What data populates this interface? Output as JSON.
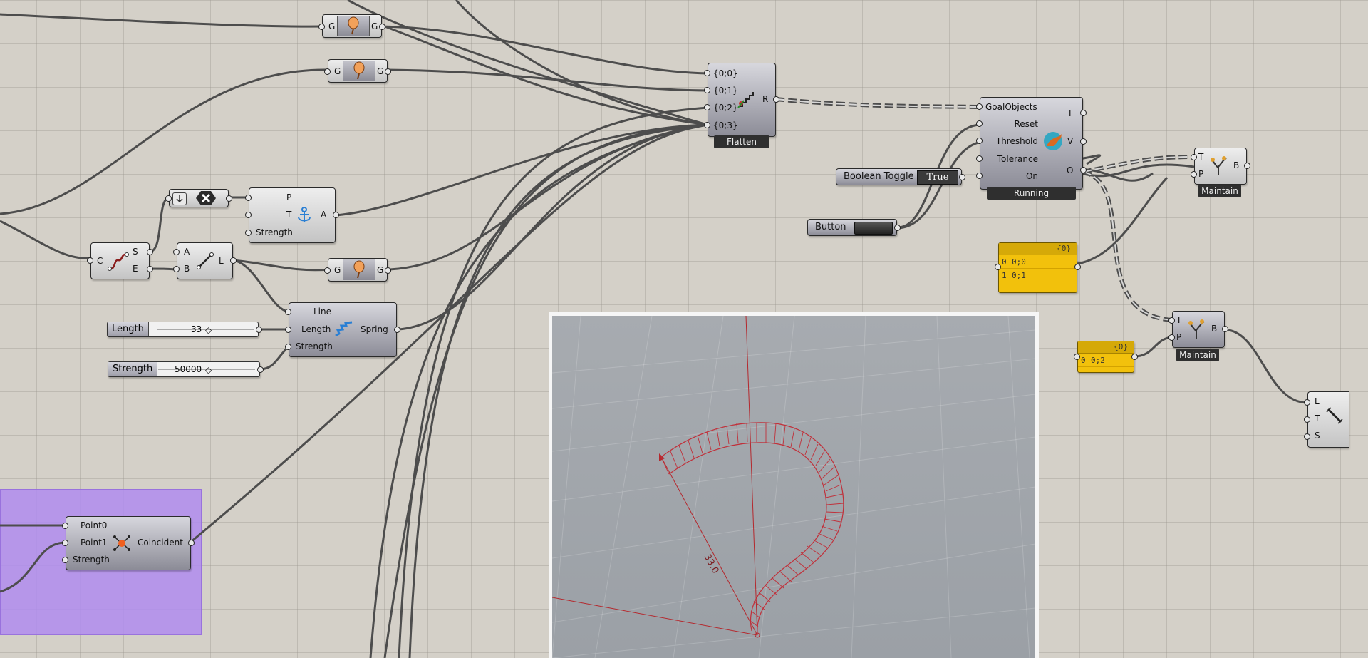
{
  "pulls": {
    "in": "G",
    "out": "G"
  },
  "merge": {
    "inputs": [
      "{0;0}",
      "{0;1}",
      "{0;2}",
      "{0;3}"
    ],
    "output": "R",
    "tag": "Flatten"
  },
  "solver": {
    "inputs": [
      "GoalObjects",
      "Reset",
      "Threshold",
      "Tolerance",
      "On"
    ],
    "outputs": [
      "I",
      "V",
      "O"
    ],
    "tag": "Running"
  },
  "boolean_toggle": {
    "label": "Boolean Toggle",
    "value": "True"
  },
  "button": {
    "label": "Button"
  },
  "anchor": {
    "inputs": [
      "P",
      "T",
      "Strength"
    ],
    "output": "A"
  },
  "endpoints": {
    "input": "C",
    "outputs": [
      "S",
      "E"
    ]
  },
  "line": {
    "inputs": [
      "A",
      "B"
    ],
    "output": "L"
  },
  "spring": {
    "inputs": [
      "Line",
      "Length",
      "Strength"
    ],
    "output": "Spring"
  },
  "length_slider": {
    "label": "Length",
    "value": "33"
  },
  "strength_slider": {
    "label": "Strength",
    "value": "50000"
  },
  "coincident": {
    "inputs": [
      "Point0",
      "Point1",
      "Strength"
    ],
    "output": "Coincident"
  },
  "panel1": {
    "header": "{0}",
    "rows": [
      {
        "i": "0",
        "v": "0;0"
      },
      {
        "i": "1",
        "v": "0;1"
      }
    ]
  },
  "panel2": {
    "header": "{0}",
    "rows": [
      {
        "i": "0",
        "v": "0;2"
      }
    ]
  },
  "maintain1": {
    "inputs": [
      "T",
      "P"
    ],
    "output": "B",
    "tag": "Maintain"
  },
  "maintain2": {
    "inputs": [
      "T",
      "P"
    ],
    "output": "B",
    "tag": "Maintain"
  },
  "preview": {
    "inputs": [
      "L",
      "T",
      "S"
    ]
  },
  "viewport": {
    "dimension_label": "33.0"
  },
  "colors": {
    "canvas": "#d4d0c8",
    "panel": "#f2c10c",
    "group": "#b08cee",
    "wire": "#4d4d4d",
    "curve": "#c0303a"
  }
}
